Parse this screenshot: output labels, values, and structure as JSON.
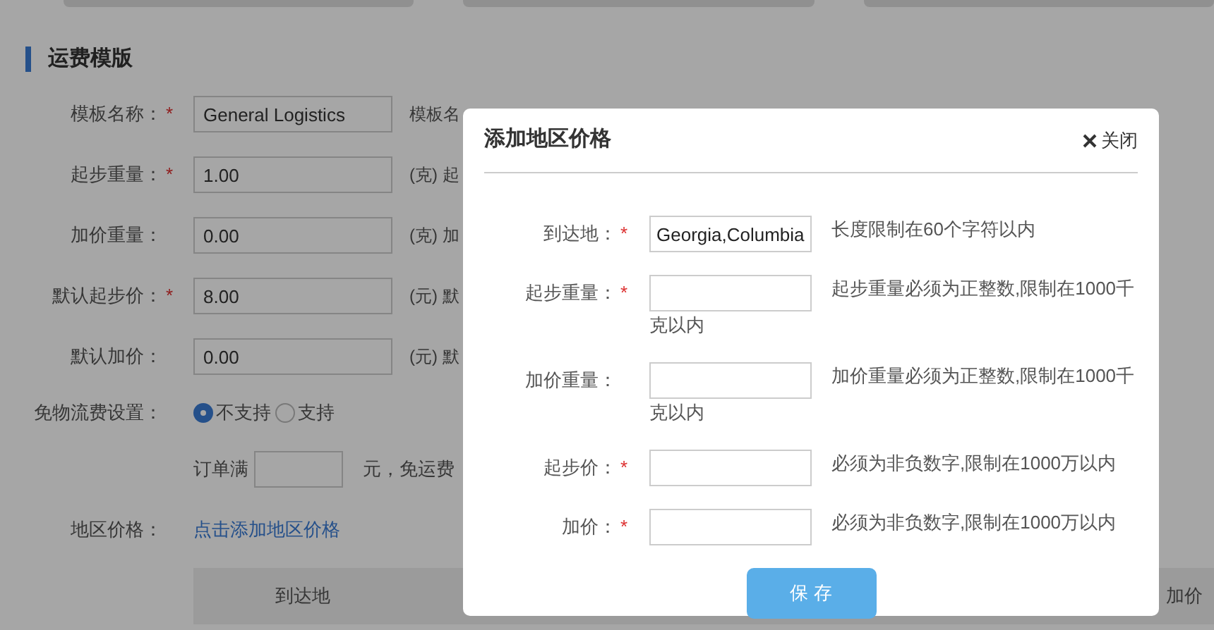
{
  "section_title": "运费模版",
  "template_form": [
    {
      "label": "模板名称：",
      "required_mark": "*",
      "value": "General Logistics",
      "note": "模板名"
    },
    {
      "label": "起步重量：",
      "required_mark": "*",
      "value": "1.00",
      "note": "(克) 起"
    },
    {
      "label": "加价重量：",
      "value": "0.00",
      "note": "(克) 加"
    },
    {
      "label": "默认起步价：",
      "required_mark": "*",
      "value": "8.00",
      "note": "(元) 默"
    },
    {
      "label": "默认加价：",
      "value": "0.00",
      "note": "(元) 默"
    }
  ],
  "free_shipping": {
    "label": "免物流费设置：",
    "options": [
      {
        "label": "不支持",
        "selected": true
      },
      {
        "label": "支持",
        "selected": false
      }
    ],
    "order_prefix": "订单满",
    "order_suffix": "元，免运费"
  },
  "region_price": {
    "label": "地区价格：",
    "link": "点击添加地区价格"
  },
  "table": {
    "columns": [
      "到达地",
      "加价"
    ]
  },
  "dialog": {
    "title": "添加地区价格",
    "close": "关闭",
    "fields": [
      {
        "label": "到达地：",
        "required_mark": "*",
        "value": "Georgia,Columbia",
        "hint": "长度限制在60个字符以内"
      },
      {
        "label": "起步重量：",
        "required_mark": "*",
        "hint": "起步重量必须为正整数,限制在1000千",
        "hint_continued": "克以内"
      },
      {
        "label": "加价重量：",
        "hint": "加价重量必须为正整数,限制在1000千",
        "hint_continued": "克以内"
      },
      {
        "label": "起步价：",
        "required_mark": "*",
        "hint": "必须为非负数字,限制在1000万以内"
      },
      {
        "label": "加价：",
        "required_mark": "*",
        "hint": "必须为非负数字,限制在1000万以内"
      }
    ],
    "save": "保 存"
  }
}
